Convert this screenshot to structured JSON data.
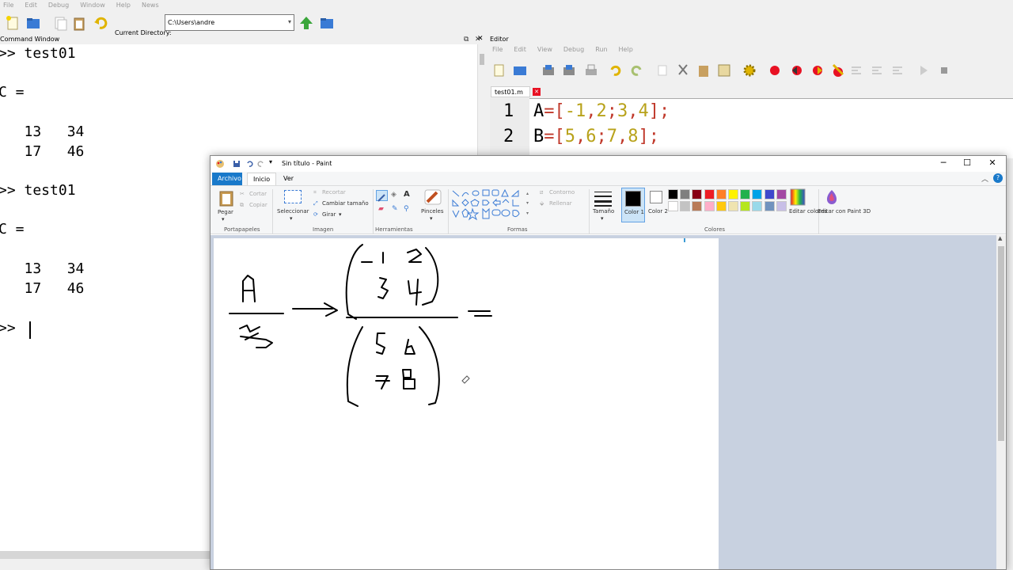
{
  "octave": {
    "menu": [
      "File",
      "Edit",
      "Debug",
      "Window",
      "Help",
      "News"
    ],
    "current_directory_label": "Current Directory:",
    "current_directory": "C:\\Users\\andre"
  },
  "command_window": {
    "title": "Command Window",
    "lines": [
      ">> test01",
      "C =",
      "   13   34",
      "   17   46",
      ">> test01",
      "C =",
      "   13   34",
      "   17   46",
      ">> "
    ]
  },
  "editor": {
    "title": "Editor",
    "menu": [
      "File",
      "Edit",
      "View",
      "Debug",
      "Run",
      "Help"
    ],
    "tab": "test01.m",
    "line_numbers": [
      "1",
      "2"
    ],
    "line1": {
      "a": "A",
      "b": "=[",
      "c": "-1",
      "d": ",",
      "e": "2",
      "f": ";",
      "g": "3",
      "h": ",",
      "i": "4",
      "j": "];"
    },
    "line2": {
      "a": "B",
      "b": "=[",
      "c": "5",
      "d": ",",
      "e": "6",
      "f": ";",
      "g": "7",
      "h": ",",
      "i": "8",
      "j": "];"
    }
  },
  "paint": {
    "title": "Sin título - Paint",
    "tabs": {
      "archivo": "Archivo",
      "inicio": "Inicio",
      "ver": "Ver"
    },
    "ribbon": {
      "pegar": "Pegar",
      "cortar": "Cortar",
      "copiar": "Copiar",
      "seleccionar": "Seleccionar",
      "recortar": "Recortar",
      "cambiar_tamano": "Cambiar tamaño",
      "girar": "Girar",
      "pinceles": "Pinceles",
      "contorno": "Contorno",
      "rellenar": "Rellenar",
      "tamano": "Tamaño",
      "color1": "Color 1",
      "color2": "Color 2",
      "editar_colores": "Editar colores",
      "editar_paint3d": "Editar con Paint 3D"
    },
    "groups": {
      "portapapeles": "Portapapeles",
      "imagen": "Imagen",
      "herramientas": "Herramientas",
      "formas": "Formas",
      "colores": "Colores"
    },
    "palette_row1": [
      "#000000",
      "#7f7f7f",
      "#880015",
      "#ed1c24",
      "#ff7f27",
      "#fff200",
      "#22b14c",
      "#00a2e8",
      "#3f48cc",
      "#a349a4"
    ],
    "palette_row2": [
      "#ffffff",
      "#c3c3c3",
      "#b97a57",
      "#ffaec9",
      "#ffc90e",
      "#efe4b0",
      "#b5e61d",
      "#99d9ea",
      "#7092be",
      "#c8bfe7"
    ]
  }
}
